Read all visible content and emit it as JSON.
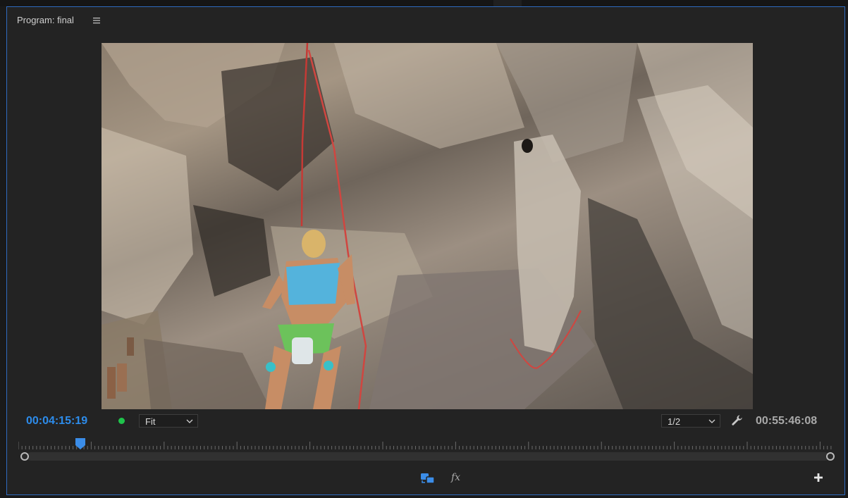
{
  "panel": {
    "title": "Program: final",
    "menu_icon": "hamburger-menu-icon"
  },
  "viewer": {
    "content": "video-frame-climber"
  },
  "controls": {
    "current_timecode": "00:04:15:19",
    "status_indicator_color": "#1fc34b",
    "zoom_select": {
      "value": "Fit"
    },
    "resolution_select": {
      "value": "1/2"
    },
    "settings_icon": "wrench-icon",
    "duration_timecode": "00:55:46:08"
  },
  "timeline": {
    "playhead_position_fraction": 0.0763,
    "zoom_scroll_range": [
      0,
      1
    ]
  },
  "toolbar": {
    "compare_icon": "compare-view-icon",
    "fx_label": "fx",
    "add_icon": "plus-icon"
  },
  "colors": {
    "accent": "#2d8ceb",
    "panel_border": "#2f6bbf",
    "background": "#232323"
  }
}
